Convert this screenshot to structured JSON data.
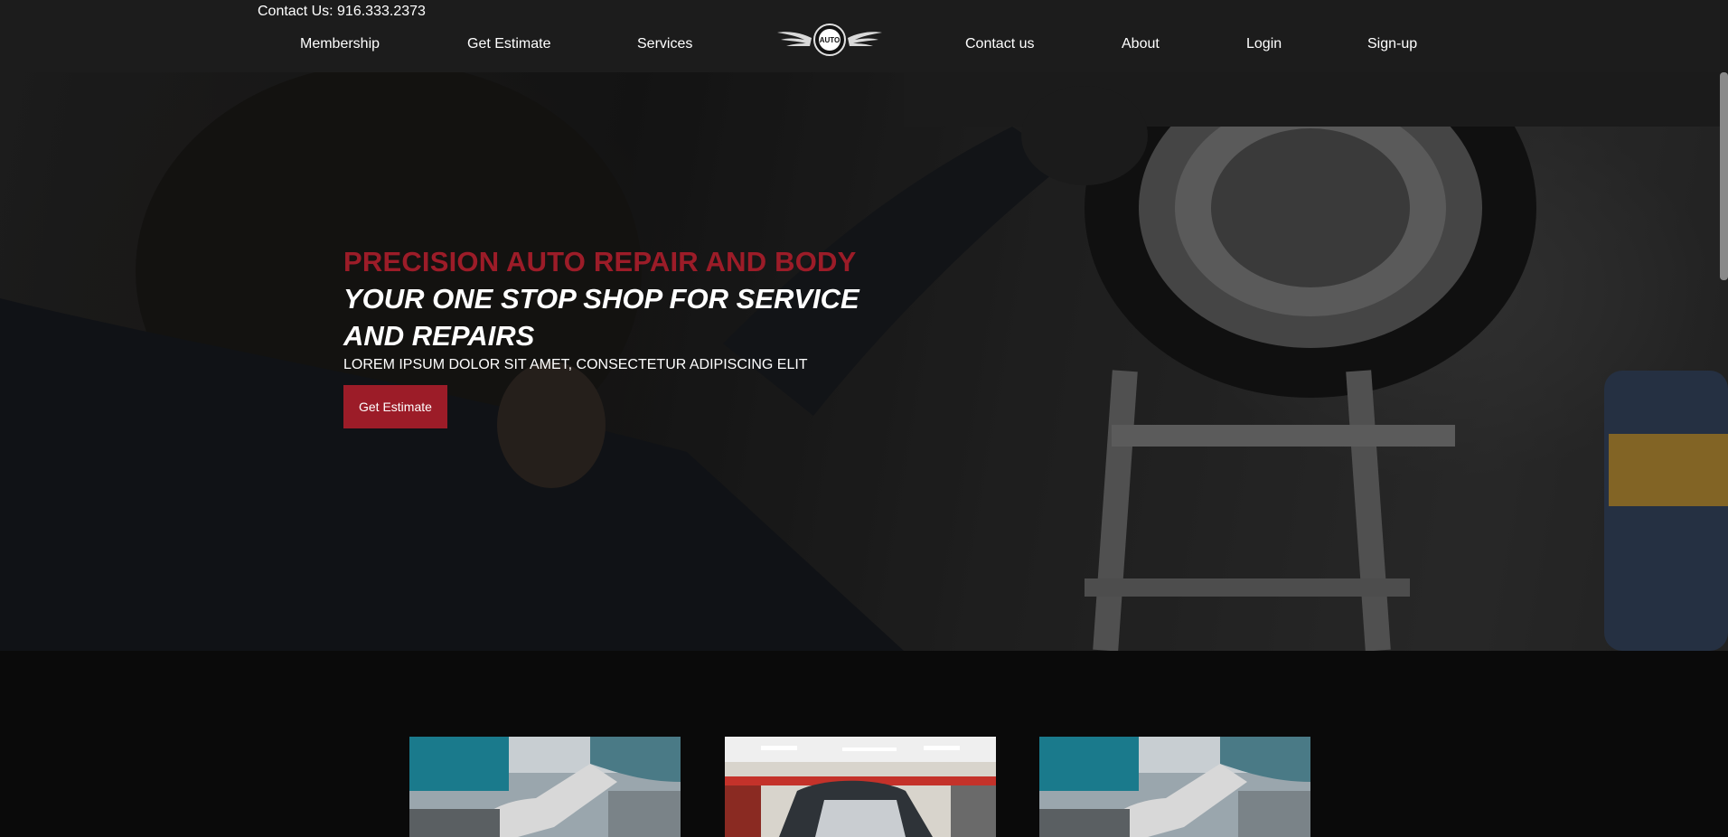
{
  "header": {
    "contact": "Contact Us: 916.333.2373",
    "nav_left": [
      "Membership",
      "Get Estimate",
      "Services"
    ],
    "nav_right": [
      "Contact us",
      "About",
      "Login",
      "Sign-up"
    ],
    "logo_text": "AUTO"
  },
  "hero": {
    "brand": "PRECISION AUTO REPAIR AND BODY",
    "tagline": "YOUR ONE STOP SHOP FOR SERVICE AND REPAIRS",
    "subtitle": "LOREM IPSUM DOLOR SIT AMET, CONSECTETUR ADIPISCING ELIT",
    "button": "Get Estimate"
  },
  "colors": {
    "accent": "#9c1c28",
    "header_bg": "#1c1c1c",
    "page_bg": "#0a0a0a"
  },
  "cards": [
    {
      "image": "mechanic-gloved-hand-photo"
    },
    {
      "image": "garage-car-hood-open-photo"
    },
    {
      "image": "mechanic-gloved-hand-photo"
    }
  ]
}
